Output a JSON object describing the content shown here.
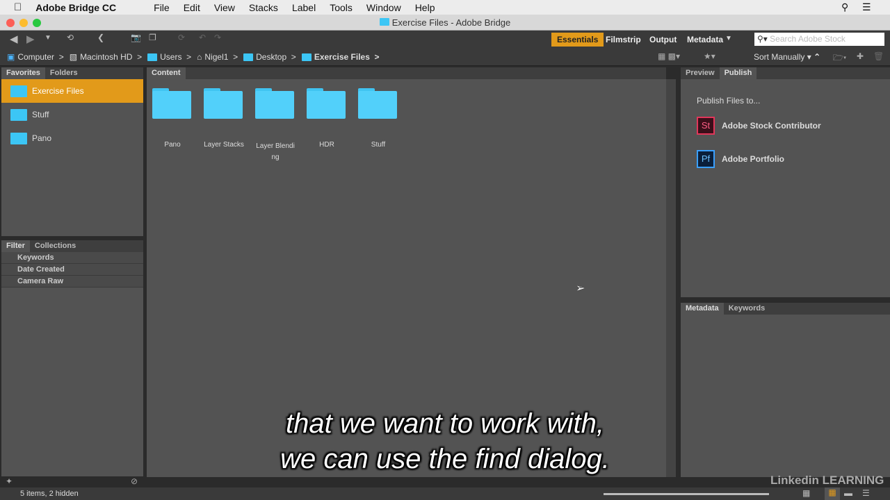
{
  "menubar": {
    "app": "Adobe Bridge CC",
    "items": [
      "File",
      "Edit",
      "View",
      "Stacks",
      "Label",
      "Tools",
      "Window",
      "Help"
    ]
  },
  "window": {
    "title": "Exercise Files - Adobe Bridge"
  },
  "workspaces": [
    "Essentials",
    "Filmstrip",
    "Output",
    "Metadata"
  ],
  "search": {
    "placeholder": "Search Adobe Stock"
  },
  "sort": "Sort Manually",
  "path": [
    "Computer",
    "Macintosh HD",
    "Users",
    "Nigel1",
    "Desktop",
    "Exercise Files"
  ],
  "left": {
    "tabs": [
      "Favorites",
      "Folders"
    ],
    "favorites": [
      "Exercise Files",
      "Stuff",
      "Pano"
    ],
    "filter_tabs": [
      "Filter",
      "Collections"
    ],
    "filters": [
      "Keywords",
      "Date Created",
      "Camera Raw"
    ]
  },
  "content": {
    "tab": "Content",
    "items": [
      "Pano",
      "Layer Stacks",
      "Layer Blendi ng",
      "HDR",
      "Stuff"
    ]
  },
  "right": {
    "tabs": [
      "Preview",
      "Publish"
    ],
    "heading": "Publish Files to...",
    "targets": [
      {
        "icon": "St",
        "label": "Adobe Stock Contributor"
      },
      {
        "icon": "Pf",
        "label": "Adobe Portfolio"
      }
    ],
    "lower_tabs": [
      "Metadata",
      "Keywords"
    ]
  },
  "status": "5 items, 2 hidden",
  "caption": [
    "that we want to work with,",
    "we can use the find dialog."
  ],
  "watermark": "Linkedin LEARNING",
  "colors": {
    "accent": "#e29a1a",
    "folder": "#52d0fa"
  }
}
